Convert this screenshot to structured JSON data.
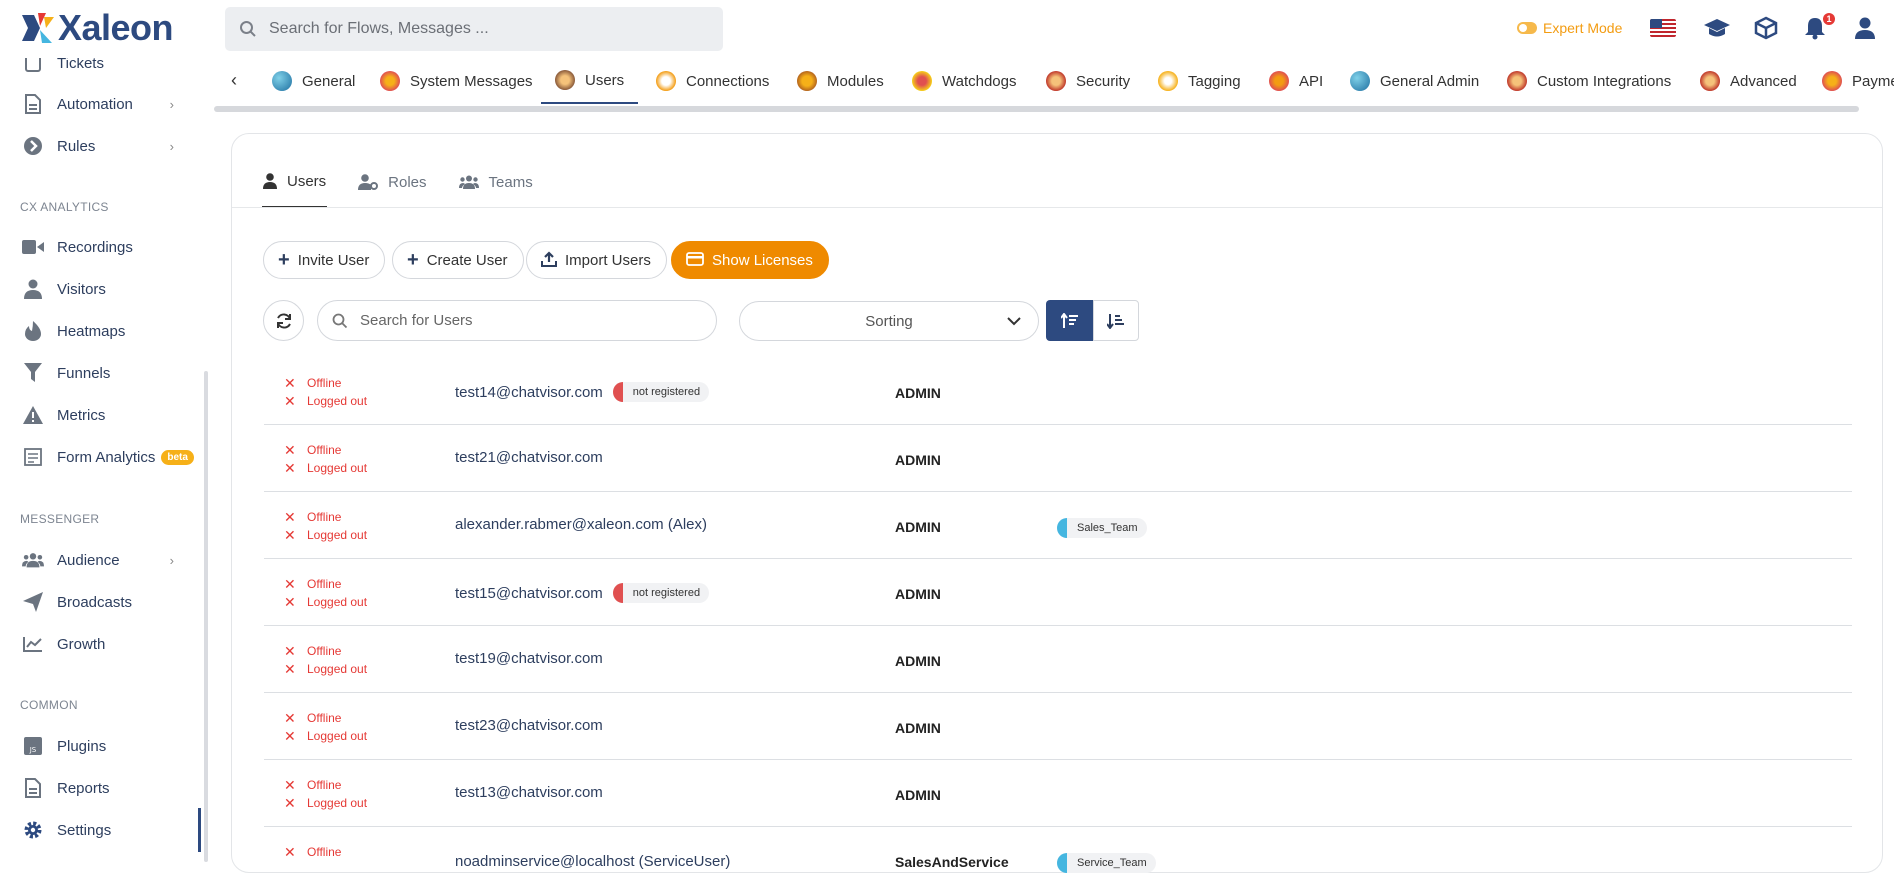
{
  "app": {
    "brand": "Xaleon"
  },
  "header": {
    "search_placeholder": "Search for Flows, Messages ...",
    "expert_mode_label": "Expert Mode",
    "notification_count": "1"
  },
  "sidebar": {
    "items": [
      {
        "label": "Tickets"
      },
      {
        "label": "Automation"
      },
      {
        "label": "Rules"
      },
      {
        "label": "Recordings"
      },
      {
        "label": "Visitors"
      },
      {
        "label": "Heatmaps"
      },
      {
        "label": "Funnels"
      },
      {
        "label": "Metrics"
      },
      {
        "label": "Form Analytics",
        "badge": "beta"
      },
      {
        "label": "Audience"
      },
      {
        "label": "Broadcasts"
      },
      {
        "label": "Growth"
      },
      {
        "label": "Plugins"
      },
      {
        "label": "Reports"
      },
      {
        "label": "Settings"
      }
    ],
    "sections": [
      "CX ANALYTICS",
      "MESSENGER",
      "COMMON"
    ]
  },
  "tabs": [
    {
      "label": "General"
    },
    {
      "label": "System Messages"
    },
    {
      "label": "Users"
    },
    {
      "label": "Connections"
    },
    {
      "label": "Modules"
    },
    {
      "label": "Watchdogs"
    },
    {
      "label": "Security"
    },
    {
      "label": "Tagging"
    },
    {
      "label": "API"
    },
    {
      "label": "General Admin"
    },
    {
      "label": "Custom Integrations"
    },
    {
      "label": "Advanced"
    },
    {
      "label": "Payme"
    }
  ],
  "subtabs": [
    {
      "label": "Users"
    },
    {
      "label": "Roles"
    },
    {
      "label": "Teams"
    }
  ],
  "actions": {
    "invite": "Invite User",
    "create": "Create User",
    "import": "Import Users",
    "licenses": "Show Licenses"
  },
  "filters": {
    "search_placeholder": "Search for Users",
    "sorting_label": "Sorting"
  },
  "users": [
    {
      "status": "Offline",
      "login": "Logged out",
      "email": "test14@chatvisor.com",
      "registration": "not registered",
      "role": "ADMIN",
      "team": ""
    },
    {
      "status": "Offline",
      "login": "Logged out",
      "email": "test21@chatvisor.com",
      "registration": "",
      "role": "ADMIN",
      "team": ""
    },
    {
      "status": "Offline",
      "login": "Logged out",
      "email": "alexander.rabmer@xaleon.com (Alex)",
      "registration": "",
      "role": "ADMIN",
      "team": "Sales_Team"
    },
    {
      "status": "Offline",
      "login": "Logged out",
      "email": "test15@chatvisor.com",
      "registration": "not registered",
      "role": "ADMIN",
      "team": ""
    },
    {
      "status": "Offline",
      "login": "Logged out",
      "email": "test19@chatvisor.com",
      "registration": "",
      "role": "ADMIN",
      "team": ""
    },
    {
      "status": "Offline",
      "login": "Logged out",
      "email": "test23@chatvisor.com",
      "registration": "",
      "role": "ADMIN",
      "team": ""
    },
    {
      "status": "Offline",
      "login": "Logged out",
      "email": "test13@chatvisor.com",
      "registration": "",
      "role": "ADMIN",
      "team": ""
    },
    {
      "status": "Offline",
      "login": "",
      "email": "noadminservice@localhost (ServiceUser)",
      "registration": "",
      "role": "SalesAndService",
      "team": "Service_Team"
    }
  ]
}
